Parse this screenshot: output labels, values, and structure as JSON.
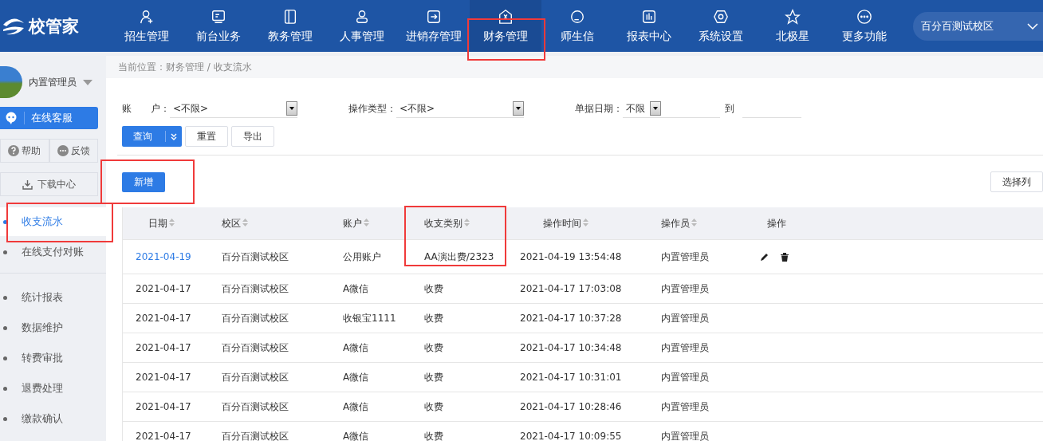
{
  "header": {
    "logo": "校管家",
    "nav": [
      {
        "label": "招生管理",
        "selected": false,
        "marked": false
      },
      {
        "label": "前台业务",
        "selected": false,
        "marked": false
      },
      {
        "label": "教务管理",
        "selected": false,
        "marked": false
      },
      {
        "label": "人事管理",
        "selected": false,
        "marked": false
      },
      {
        "label": "进销存管理",
        "selected": false,
        "marked": false
      },
      {
        "label": "财务管理",
        "selected": true,
        "marked": true
      },
      {
        "label": "师生信",
        "selected": false,
        "marked": false
      },
      {
        "label": "报表中心",
        "selected": false,
        "marked": false
      },
      {
        "label": "系统设置",
        "selected": false,
        "marked": false
      },
      {
        "label": "北极星",
        "selected": false,
        "marked": false
      },
      {
        "label": "更多功能",
        "selected": false,
        "marked": false
      }
    ],
    "campus": "百分百测试校区"
  },
  "sidebar": {
    "user": "内置管理员",
    "service": "在线客服",
    "help": "帮助",
    "feedback": "反馈",
    "download": "下载中心",
    "groups": [
      [
        {
          "label": "收支流水",
          "selected": true,
          "marked": true
        },
        {
          "label": "在线支付对账",
          "selected": false,
          "marked": false
        }
      ],
      [
        {
          "label": "统计报表",
          "selected": false,
          "marked": false
        },
        {
          "label": "数据维护",
          "selected": false,
          "marked": false
        },
        {
          "label": "转费审批",
          "selected": false,
          "marked": false
        },
        {
          "label": "退费处理",
          "selected": false,
          "marked": false
        },
        {
          "label": "缴款确认",
          "selected": false,
          "marked": false
        }
      ]
    ]
  },
  "breadcrumb": "当前位置：财务管理 / 收支流水",
  "filters": {
    "account_label": "账　　户：",
    "account_value": "<不限>",
    "type_label": "操作类型：",
    "type_value": "<不限>",
    "date_label": "单据日期：",
    "date_value": "不限",
    "to": "到"
  },
  "buttons": {
    "query": "查询",
    "reset": "重置",
    "export": "导出",
    "add": "新增",
    "add_marked": true,
    "columns": "选择列"
  },
  "table": {
    "columns": [
      {
        "label": "日期",
        "sortable": true,
        "marked": false
      },
      {
        "label": "校区",
        "sortable": true,
        "marked": false
      },
      {
        "label": "账户",
        "sortable": true,
        "marked": false
      },
      {
        "label": "收支类别",
        "sortable": true,
        "marked": true
      },
      {
        "label": "操作时间",
        "sortable": true,
        "marked": false
      },
      {
        "label": "操作员",
        "sortable": true,
        "marked": false
      },
      {
        "label": "操作",
        "sortable": false,
        "marked": false
      }
    ],
    "rows": [
      {
        "date": "2021-04-19",
        "link": true,
        "campus": "百分百测试校区",
        "account": "公用账户",
        "category": "AA演出费/2323",
        "time": "2021-04-19 13:54:48",
        "operator": "内置管理员",
        "actions": true
      },
      {
        "date": "2021-04-17",
        "link": false,
        "campus": "百分百测试校区",
        "account": "A微信",
        "category": "收费",
        "time": "2021-04-17 17:03:08",
        "operator": "内置管理员",
        "actions": false
      },
      {
        "date": "2021-04-17",
        "link": false,
        "campus": "百分百测试校区",
        "account": "收银宝1111",
        "category": "收费",
        "time": "2021-04-17 10:37:28",
        "operator": "内置管理员",
        "actions": false
      },
      {
        "date": "2021-04-17",
        "link": false,
        "campus": "百分百测试校区",
        "account": "A微信",
        "category": "收费",
        "time": "2021-04-17 10:34:48",
        "operator": "内置管理员",
        "actions": false
      },
      {
        "date": "2021-04-17",
        "link": false,
        "campus": "百分百测试校区",
        "account": "A微信",
        "category": "收费",
        "time": "2021-04-17 10:31:01",
        "operator": "内置管理员",
        "actions": false
      },
      {
        "date": "2021-04-17",
        "link": false,
        "campus": "百分百测试校区",
        "account": "A微信",
        "category": "收费",
        "time": "2021-04-17 10:28:46",
        "operator": "内置管理员",
        "actions": false
      },
      {
        "date": "2021-04-17",
        "link": false,
        "campus": "百分百测试校区",
        "account": "A微信",
        "category": "收费",
        "time": "2021-04-17 10:09:55",
        "operator": "内置管理员",
        "actions": false
      }
    ]
  }
}
